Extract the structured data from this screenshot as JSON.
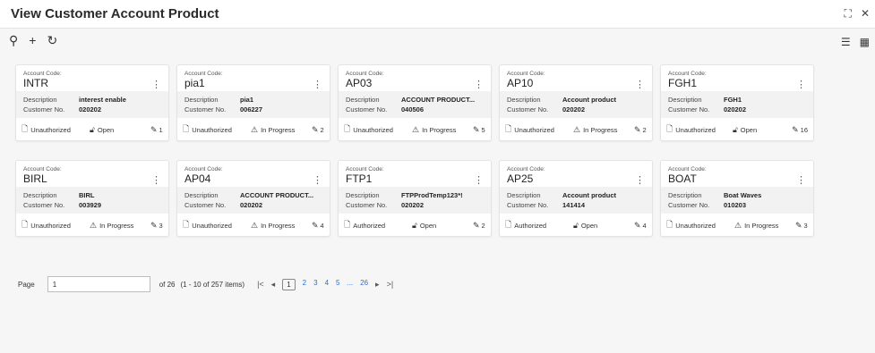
{
  "window": {
    "title": "View Customer Account Product",
    "controls": {
      "restore": "⛶",
      "close": "✕"
    }
  },
  "toolbar": {
    "search": "⚲",
    "add": "+",
    "refresh": "↻"
  },
  "view_toggle": {
    "list": "☰",
    "grid": "▦"
  },
  "card_labels": {
    "account_code": "Account Code:",
    "description": "Description",
    "customer_no": "Customer No."
  },
  "cards": [
    {
      "code": "INTR",
      "description": "interest enable",
      "customer_no": "020202",
      "auth": "Unauthorized",
      "status": "Open",
      "edits": "1",
      "status_icon": "lock-open-icon"
    },
    {
      "code": "pia1",
      "description": "pia1",
      "customer_no": "006227",
      "auth": "Unauthorized",
      "status": "In Progress",
      "edits": "2",
      "status_icon": "warning-icon"
    },
    {
      "code": "AP03",
      "description": "ACCOUNT PRODUCT...",
      "customer_no": "040506",
      "auth": "Unauthorized",
      "status": "In Progress",
      "edits": "5",
      "status_icon": "warning-icon"
    },
    {
      "code": "AP10",
      "description": "Account product",
      "customer_no": "020202",
      "auth": "Unauthorized",
      "status": "In Progress",
      "edits": "2",
      "status_icon": "warning-icon"
    },
    {
      "code": "FGH1",
      "description": "FGH1",
      "customer_no": "020202",
      "auth": "Unauthorized",
      "status": "Open",
      "edits": "16",
      "status_icon": "lock-open-icon"
    },
    {
      "code": "BIRL",
      "description": "BIRL",
      "customer_no": "003929",
      "auth": "Unauthorized",
      "status": "In Progress",
      "edits": "3",
      "status_icon": "warning-icon"
    },
    {
      "code": "AP04",
      "description": "ACCOUNT PRODUCT...",
      "customer_no": "020202",
      "auth": "Unauthorized",
      "status": "In Progress",
      "edits": "4",
      "status_icon": "warning-icon"
    },
    {
      "code": "FTP1",
      "description": "FTPProdTemp123*!",
      "customer_no": "020202",
      "auth": "Authorized",
      "status": "Open",
      "edits": "2",
      "status_icon": "lock-open-icon"
    },
    {
      "code": "AP25",
      "description": "Account product",
      "customer_no": "141414",
      "auth": "Authorized",
      "status": "Open",
      "edits": "4",
      "status_icon": "lock-open-icon"
    },
    {
      "code": "BOAT",
      "description": "Boat Waves",
      "customer_no": "010203",
      "auth": "Unauthorized",
      "status": "In Progress",
      "edits": "3",
      "status_icon": "warning-icon"
    }
  ],
  "pagination": {
    "label": "Page",
    "value": "1",
    "of": "of 26",
    "range": "(1 - 10 of 257 items)",
    "first": "|<",
    "prev": "◂",
    "pages": [
      "1",
      "2",
      "3",
      "4",
      "5",
      "...",
      "26"
    ],
    "current": "1",
    "next": "▸",
    "last": ">|"
  },
  "colors": {
    "link": "#2c6ed5",
    "background": "#f6f6f6",
    "card": "#ffffff"
  }
}
